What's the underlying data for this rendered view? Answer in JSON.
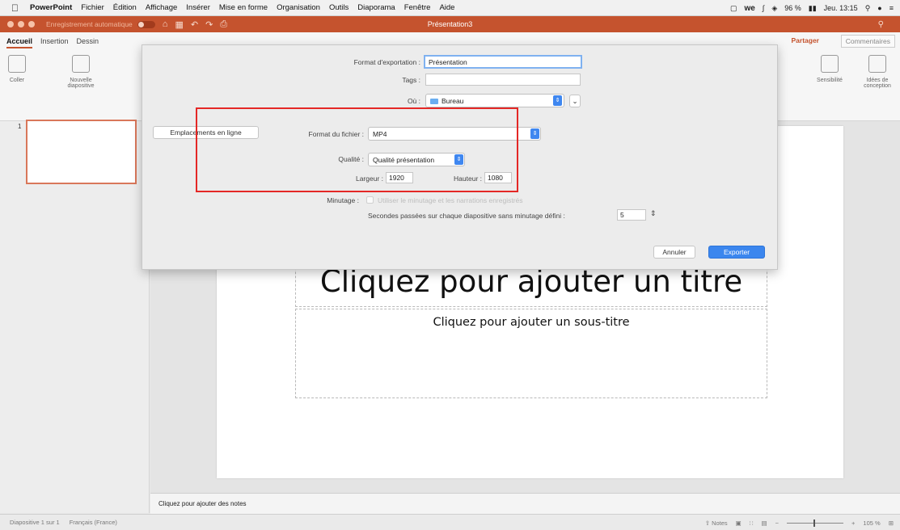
{
  "menubar": {
    "app": "PowerPoint",
    "items": [
      "Fichier",
      "Édition",
      "Affichage",
      "Insérer",
      "Mise en forme",
      "Organisation",
      "Outils",
      "Diaporama",
      "Fenêtre",
      "Aide"
    ],
    "battery": "96 %",
    "datetime": "Jeu. 13:15"
  },
  "titlebar": {
    "autosave": "Enregistrement automatique",
    "doc_title": "Présentation3"
  },
  "ribbon": {
    "tabs": [
      "Accueil",
      "Insertion",
      "Dessin"
    ],
    "coller": "Coller",
    "nouvelle_diapositive": "Nouvelle diapositive",
    "share": "Partager",
    "comments": "Commentaires",
    "sensibilite": "Sensibilité",
    "idees": "Idées de conception"
  },
  "slides": {
    "thumbnail_number": "1"
  },
  "slide": {
    "title_placeholder": "Cliquez pour ajouter un titre",
    "subtitle_placeholder": "Cliquez pour ajouter un sous-titre"
  },
  "notes": {
    "placeholder": "Cliquez pour ajouter des notes"
  },
  "status": {
    "slide_info": "Diapositive 1 sur 1",
    "language": "Français (France)",
    "notes": "Notes",
    "zoom": "105 %"
  },
  "export_dialog": {
    "export_as_label": "Format d'exportation :",
    "export_as_value": "Présentation",
    "tags_label": "Tags :",
    "tags_value": "",
    "where_label": "Où :",
    "where_value": "Bureau",
    "online_locations_button": "Emplacements en ligne",
    "file_format_label": "Format du fichier :",
    "file_format_value": "MP4",
    "quality_label": "Qualité :",
    "quality_value": "Qualité présentation",
    "width_label": "Largeur :",
    "width_value": "1920",
    "height_label": "Hauteur :",
    "height_value": "1080",
    "timing_label": "Minutage :",
    "timing_checkbox_label": "Utiliser le minutage et les narrations enregistrés",
    "seconds_label": "Secondes passées sur chaque diapositive sans minutage défini :",
    "seconds_value": "5",
    "cancel_button": "Annuler",
    "export_button": "Exporter"
  },
  "colors": {
    "titlebar": "#c5532e",
    "highlight_box": "#e42826",
    "primary_button": "#3b86ee"
  }
}
